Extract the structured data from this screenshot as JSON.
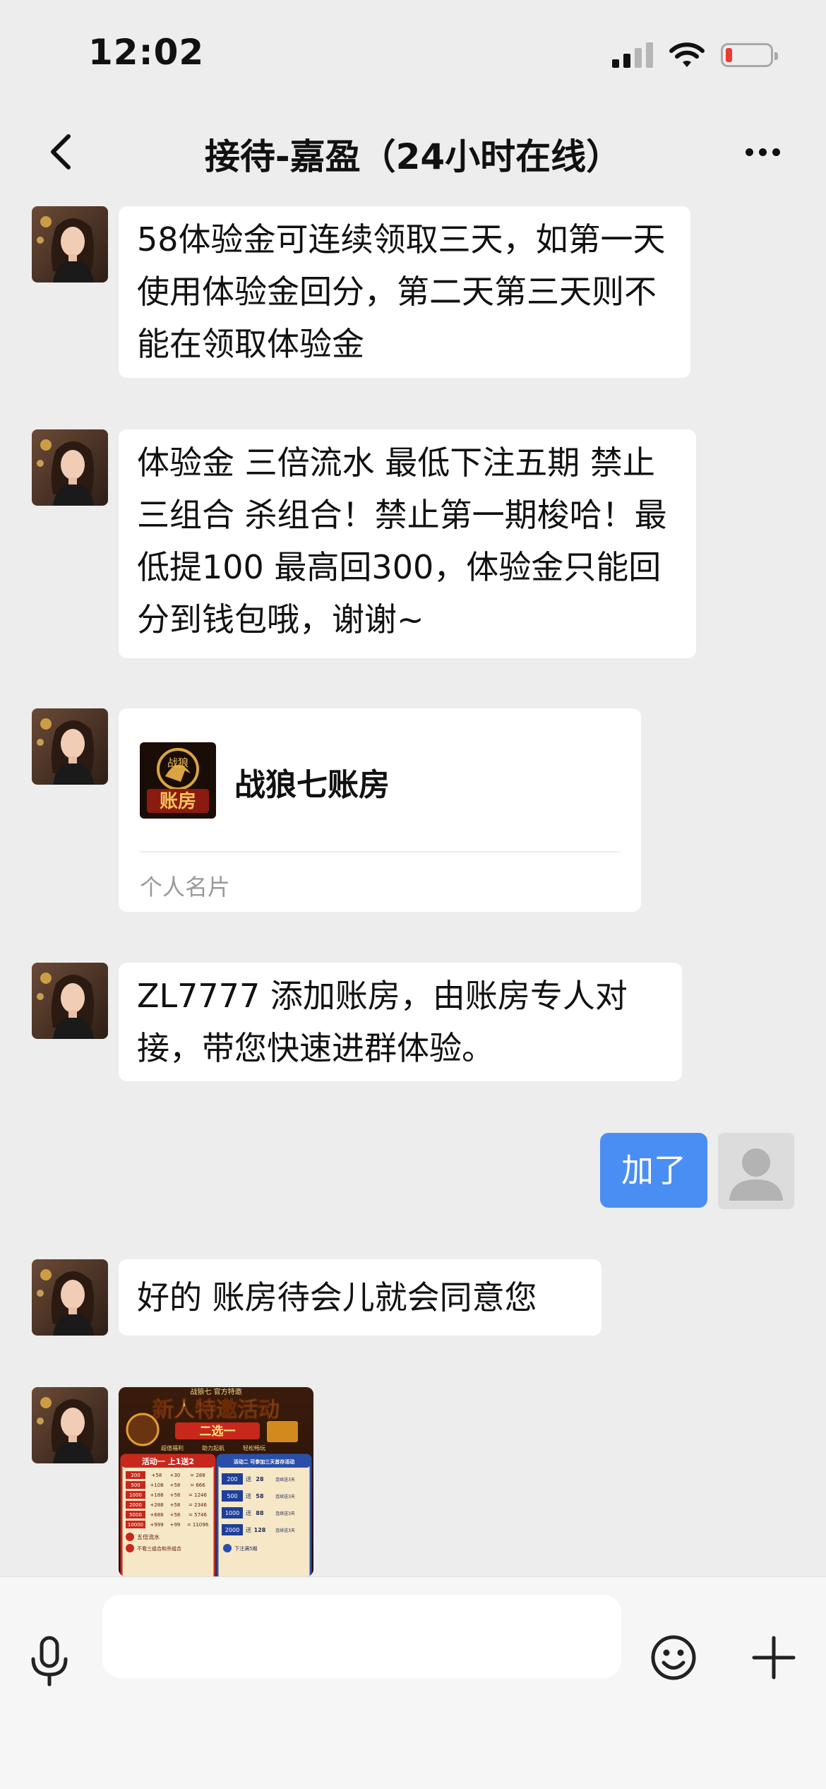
{
  "status_bar": {
    "time": "12:02"
  },
  "header": {
    "title": "接待-嘉盈（24小时在线）"
  },
  "messages": [
    {
      "sender": "agent",
      "text": "58体验金可连续领取三天，如第一天使用体验金回分，第二天第三天则不能在领取体验金"
    },
    {
      "sender": "agent",
      "text": "体验金  三倍流水 最低下注五期 禁止三组合 杀组合！禁止第一期梭哈！最低提100 最高回300，体验金只能回分到钱包哦，谢谢~"
    },
    {
      "sender": "agent",
      "type": "contact_card",
      "card": {
        "name": "战狼七账房",
        "card_type": "个人名片",
        "logo_text": "账房",
        "logo_top_text": "战狼"
      }
    },
    {
      "sender": "agent",
      "text": "ZL7777 添加账房，由账房专人对接，带您快速进群体验。"
    },
    {
      "sender": "me",
      "text": "加了"
    },
    {
      "sender": "agent",
      "text": "好的  账房待会儿就会同意您"
    },
    {
      "sender": "agent",
      "type": "image",
      "image": {
        "header": "战狼七 官方特邀",
        "title": "新人特邀活动",
        "subtitle": "二选一",
        "features": [
          "超值福利",
          "助力起航",
          "轻松畅玩"
        ],
        "left_panel": {
          "title": "活动一 上1送2",
          "rows": [
            [
              "200",
              "+58",
              "+30",
              "= 288"
            ],
            [
              "500",
              "+108",
              "+58",
              "= 666"
            ],
            [
              "1000",
              "+188",
              "+58",
              "= 1246"
            ],
            [
              "2000",
              "+288",
              "+58",
              "= 2346"
            ],
            [
              "5000",
              "+688",
              "+58",
              "= 5746"
            ],
            [
              "10000",
              "+999",
              "+99",
              "= 11098"
            ]
          ],
          "notes": [
            "五倍流水",
            "不看三组合和杀组合"
          ]
        },
        "right_panel": {
          "title": "活动二 可参加三天首存活动",
          "rows": [
            [
              "200",
              "送",
              "28",
              "连续送3天"
            ],
            [
              "500",
              "送",
              "58",
              "连续送3天"
            ],
            [
              "1000",
              "送",
              "88",
              "连续送3天"
            ],
            [
              "2000",
              "送",
              "128",
              "连续送3天"
            ]
          ],
          "note": "下注满5期"
        }
      }
    }
  ],
  "input_bar": {
    "placeholder": ""
  },
  "colors": {
    "background": "#ededed",
    "my_bubble": "#4a8ef3",
    "agent_bubble": "#ffffff"
  },
  "icons": [
    "signal-icon",
    "wifi-icon",
    "battery-icon",
    "back-arrow-icon",
    "more-icon",
    "voice-icon",
    "emoji-icon",
    "plus-icon"
  ]
}
